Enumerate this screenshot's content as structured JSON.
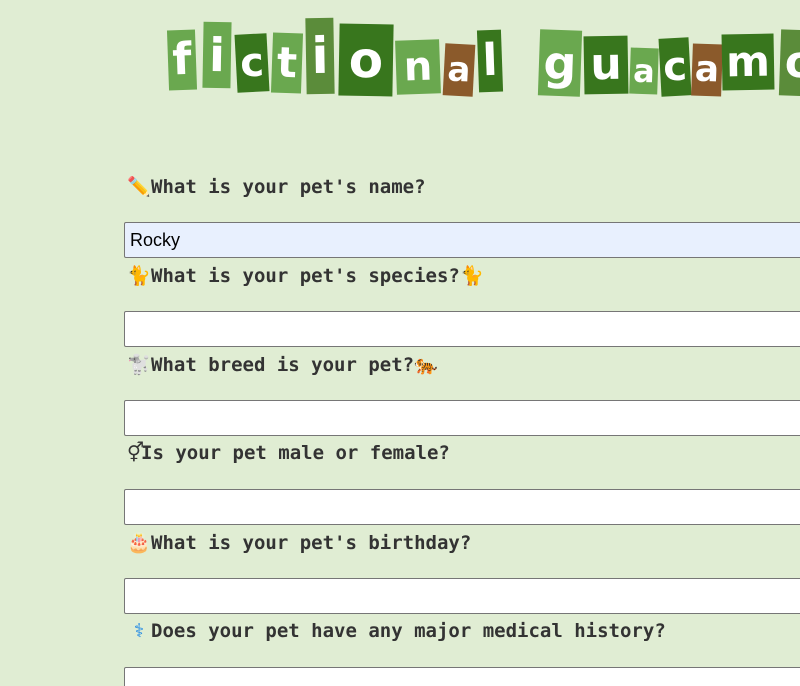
{
  "logo": {
    "word1": [
      "f",
      "i",
      "c",
      "t",
      "i",
      "o",
      "n",
      "a",
      "l"
    ],
    "word2": [
      "g",
      "u",
      "a",
      "c",
      "a",
      "m",
      "o"
    ]
  },
  "form": {
    "questions": [
      {
        "icon": "pencil-icon",
        "emoji": "✏️",
        "label": "What is your pet's name?",
        "value": "Rocky"
      },
      {
        "icon": "cat-icon",
        "emoji": "🐈",
        "label": "What is your pet's species?",
        "trailing_emoji": "🐈",
        "value": ""
      },
      {
        "icon": "dog-icon",
        "emoji": "🐩",
        "label": "What breed is your pet?",
        "trailing_emoji": "🐅",
        "value": ""
      },
      {
        "icon": "gender-icon",
        "emoji": "⚥",
        "label": "Is your pet male or female?",
        "value": ""
      },
      {
        "icon": "birthday-cake-icon",
        "emoji": "🎂",
        "label": "What is your pet's birthday?",
        "value": ""
      },
      {
        "icon": "medical-icon",
        "emoji": "⚕",
        "label": "Does your pet have any major medical history?",
        "value": ""
      }
    ]
  },
  "colors": {
    "background": "#e0edd3",
    "tile_light": "#6aa84f",
    "tile_dark": "#38761d",
    "tile_brown": "#8b5a2b",
    "filled_field": "#e8f0fe"
  }
}
